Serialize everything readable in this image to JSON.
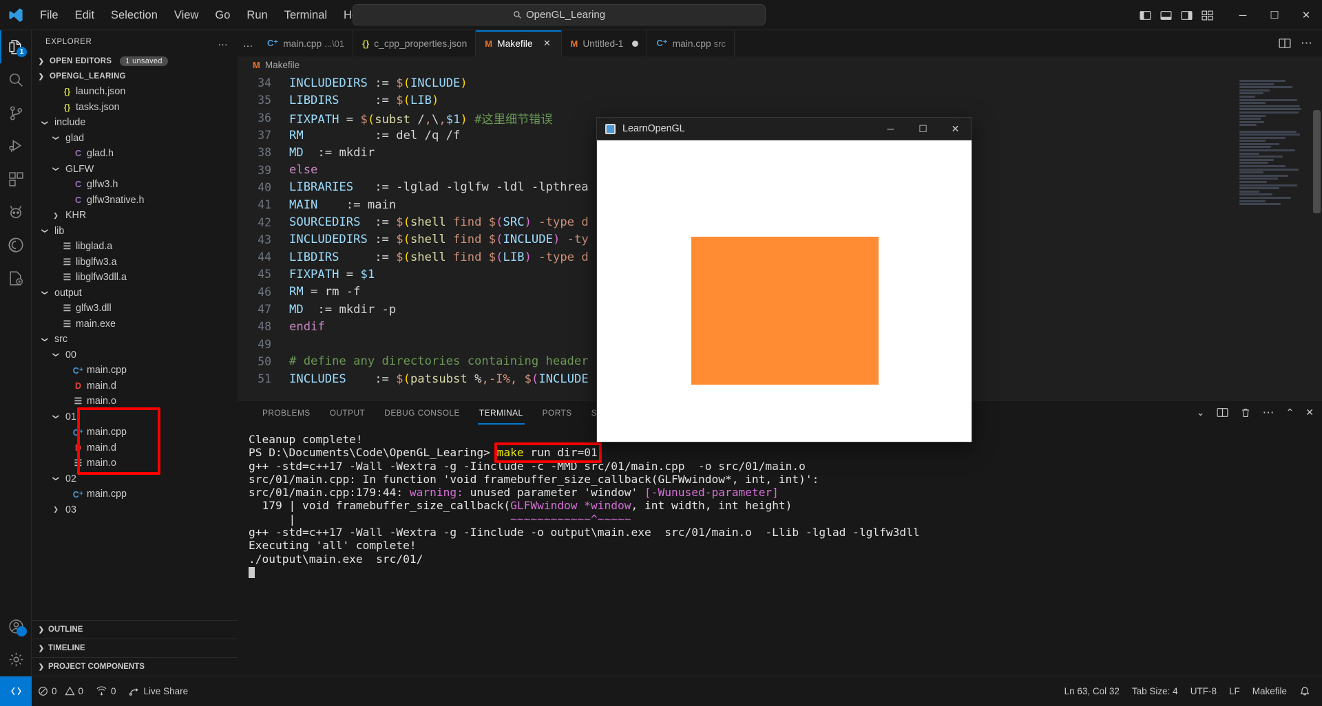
{
  "titlebar": {
    "menus": [
      "File",
      "Edit",
      "Selection",
      "View",
      "Go",
      "Run",
      "Terminal",
      "Help"
    ],
    "search_text": "OpenGL_Learing",
    "search_icon": "search-icon",
    "back_arrow": "←",
    "forward_arrow": "→",
    "minimize": "─",
    "maximize": "☐",
    "close": "✕"
  },
  "activitybar": {
    "items": [
      {
        "name": "explorer",
        "badge": "1",
        "active": true
      },
      {
        "name": "search",
        "badge": "",
        "active": false
      },
      {
        "name": "source-control",
        "badge": "",
        "active": false
      },
      {
        "name": "run-and-debug",
        "badge": "",
        "active": false
      },
      {
        "name": "extensions",
        "badge": "",
        "active": false
      },
      {
        "name": "platformio",
        "badge": "",
        "active": false
      },
      {
        "name": "remote-explorer",
        "badge": "",
        "active": false
      },
      {
        "name": "cpp-config",
        "badge": "",
        "active": false
      }
    ],
    "bottom": [
      {
        "name": "accounts",
        "badge": "1"
      },
      {
        "name": "settings",
        "badge": ""
      }
    ]
  },
  "sidebar": {
    "header_title": "EXPLORER",
    "more_actions": "…",
    "open_editors_label": "OPEN EDITORS",
    "open_editors_badge": "1 unsaved",
    "workspace_label": "OPENGL_LEARING",
    "tree": [
      {
        "indent": 1,
        "chev": "",
        "icon": "json",
        "icon_text": "{}",
        "label": "launch.json"
      },
      {
        "indent": 1,
        "chev": "",
        "icon": "json",
        "icon_text": "{}",
        "label": "tasks.json"
      },
      {
        "indent": 0,
        "chev": "⌄",
        "icon": "folder",
        "icon_text": "",
        "label": "include"
      },
      {
        "indent": 1,
        "chev": "⌄",
        "icon": "folder",
        "icon_text": "",
        "label": "glad"
      },
      {
        "indent": 2,
        "chev": "",
        "icon": "c",
        "icon_text": "C",
        "label": "glad.h"
      },
      {
        "indent": 1,
        "chev": "⌄",
        "icon": "folder",
        "icon_text": "",
        "label": "GLFW"
      },
      {
        "indent": 2,
        "chev": "",
        "icon": "c",
        "icon_text": "C",
        "label": "glfw3.h"
      },
      {
        "indent": 2,
        "chev": "",
        "icon": "c",
        "icon_text": "C",
        "label": "glfw3native.h"
      },
      {
        "indent": 1,
        "chev": "›",
        "icon": "folder",
        "icon_text": "",
        "label": "KHR"
      },
      {
        "indent": 0,
        "chev": "⌄",
        "icon": "folder",
        "icon_text": "",
        "label": "lib"
      },
      {
        "indent": 1,
        "chev": "",
        "icon": "file",
        "icon_text": "☰",
        "label": "libglad.a"
      },
      {
        "indent": 1,
        "chev": "",
        "icon": "file",
        "icon_text": "☰",
        "label": "libglfw3.a"
      },
      {
        "indent": 1,
        "chev": "",
        "icon": "file",
        "icon_text": "☰",
        "label": "libglfw3dll.a"
      },
      {
        "indent": 0,
        "chev": "⌄",
        "icon": "folder",
        "icon_text": "",
        "label": "output"
      },
      {
        "indent": 1,
        "chev": "",
        "icon": "file",
        "icon_text": "☰",
        "label": "glfw3.dll"
      },
      {
        "indent": 1,
        "chev": "",
        "icon": "file",
        "icon_text": "☰",
        "label": "main.exe"
      },
      {
        "indent": 0,
        "chev": "⌄",
        "icon": "folder",
        "icon_text": "",
        "label": "src"
      },
      {
        "indent": 1,
        "chev": "⌄",
        "icon": "folder",
        "icon_text": "",
        "label": "00"
      },
      {
        "indent": 2,
        "chev": "",
        "icon": "cpp",
        "icon_text": "C⁺",
        "label": "main.cpp"
      },
      {
        "indent": 2,
        "chev": "",
        "icon": "d",
        "icon_text": "D",
        "label": "main.d"
      },
      {
        "indent": 2,
        "chev": "",
        "icon": "file",
        "icon_text": "☰",
        "label": "main.o"
      },
      {
        "indent": 1,
        "chev": "⌄",
        "icon": "folder",
        "icon_text": "",
        "label": "01"
      },
      {
        "indent": 2,
        "chev": "",
        "icon": "cpp",
        "icon_text": "C⁺",
        "label": "main.cpp"
      },
      {
        "indent": 2,
        "chev": "",
        "icon": "d",
        "icon_text": "D",
        "label": "main.d"
      },
      {
        "indent": 2,
        "chev": "",
        "icon": "file",
        "icon_text": "☰",
        "label": "main.o"
      },
      {
        "indent": 1,
        "chev": "⌄",
        "icon": "folder",
        "icon_text": "",
        "label": "02"
      },
      {
        "indent": 2,
        "chev": "",
        "icon": "cpp",
        "icon_text": "C⁺",
        "label": "main.cpp"
      },
      {
        "indent": 1,
        "chev": "›",
        "icon": "folder",
        "icon_text": "",
        "label": "03"
      }
    ],
    "bottom_sections": [
      "OUTLINE",
      "TIMELINE",
      "PROJECT COMPONENTS"
    ],
    "annotation_color": "#ff0000"
  },
  "tabs": {
    "overflow": "…",
    "items": [
      {
        "icon": "cpp",
        "icon_text": "C⁺",
        "label": "main.cpp",
        "sub": "...\\01",
        "active": false,
        "dirty": false,
        "close": ""
      },
      {
        "icon": "json",
        "icon_text": "{}",
        "label": "c_cpp_properties.json",
        "sub": "",
        "active": false,
        "dirty": false,
        "close": ""
      },
      {
        "icon": "makefile",
        "icon_text": "M",
        "label": "Makefile",
        "sub": "",
        "active": true,
        "dirty": false,
        "close": "✕"
      },
      {
        "icon": "makefile",
        "icon_text": "M",
        "label": "Untitled-1",
        "sub": "",
        "active": false,
        "dirty": true,
        "close": ""
      },
      {
        "icon": "cpp",
        "icon_text": "C⁺",
        "label": "main.cpp",
        "sub": "src",
        "active": false,
        "dirty": false,
        "close": ""
      }
    ],
    "actions": [
      "split-editor-icon",
      "more-actions-icon"
    ]
  },
  "breadcrumb": {
    "icon_text": "M",
    "label": "Makefile"
  },
  "code": {
    "lines": [
      {
        "n": "34",
        "tokens": [
          {
            "t": "INCLUDEDIRS ",
            "c": "k-var"
          },
          {
            "t": ":= ",
            "c": "k-op"
          },
          {
            "t": "$",
            "c": "k-dollar"
          },
          {
            "t": "(",
            "c": "k-paren"
          },
          {
            "t": "INCLUDE",
            "c": "k-var"
          },
          {
            "t": ")",
            "c": "k-paren"
          }
        ]
      },
      {
        "n": "35",
        "tokens": [
          {
            "t": "LIBDIRS     ",
            "c": "k-var"
          },
          {
            "t": ":= ",
            "c": "k-op"
          },
          {
            "t": "$",
            "c": "k-dollar"
          },
          {
            "t": "(",
            "c": "k-paren"
          },
          {
            "t": "LIB",
            "c": "k-var"
          },
          {
            "t": ")",
            "c": "k-paren"
          }
        ]
      },
      {
        "n": "36",
        "tokens": [
          {
            "t": "FIXPATH ",
            "c": "k-var"
          },
          {
            "t": "= ",
            "c": "k-op"
          },
          {
            "t": "$",
            "c": "k-dollar"
          },
          {
            "t": "(",
            "c": "k-paren"
          },
          {
            "t": "subst ",
            "c": "k-func"
          },
          {
            "t": "/",
            "c": "k-plain"
          },
          {
            "t": ",",
            "c": "k-dollar"
          },
          {
            "t": "\\",
            "c": "k-plain"
          },
          {
            "t": ",",
            "c": "k-dollar"
          },
          {
            "t": "$1",
            "c": "k-var"
          },
          {
            "t": ")",
            "c": "k-paren"
          },
          {
            "t": " #这里细节错误",
            "c": "k-com"
          }
        ]
      },
      {
        "n": "37",
        "tokens": [
          {
            "t": "RM          ",
            "c": "k-var"
          },
          {
            "t": ":= ",
            "c": "k-op"
          },
          {
            "t": "del /q /f",
            "c": "k-plain"
          }
        ]
      },
      {
        "n": "38",
        "tokens": [
          {
            "t": "MD  ",
            "c": "k-var"
          },
          {
            "t": ":= ",
            "c": "k-op"
          },
          {
            "t": "mkdir",
            "c": "k-plain"
          }
        ]
      },
      {
        "n": "39",
        "tokens": [
          {
            "t": "else",
            "c": "k-kw"
          }
        ]
      },
      {
        "n": "40",
        "tokens": [
          {
            "t": "LIBRARIES   ",
            "c": "k-var"
          },
          {
            "t": ":= ",
            "c": "k-op"
          },
          {
            "t": "-lglad -lglfw -ldl -lpthrea",
            "c": "k-plain"
          }
        ]
      },
      {
        "n": "41",
        "tokens": [
          {
            "t": "MAIN    ",
            "c": "k-var"
          },
          {
            "t": ":= ",
            "c": "k-op"
          },
          {
            "t": "main",
            "c": "k-plain"
          }
        ]
      },
      {
        "n": "42",
        "tokens": [
          {
            "t": "SOURCEDIRS  ",
            "c": "k-var"
          },
          {
            "t": ":= ",
            "c": "k-op"
          },
          {
            "t": "$",
            "c": "k-dollar"
          },
          {
            "t": "(",
            "c": "k-paren"
          },
          {
            "t": "shell ",
            "c": "k-func"
          },
          {
            "t": "find ",
            "c": "k-str"
          },
          {
            "t": "$",
            "c": "k-dollar"
          },
          {
            "t": "(",
            "c": "k-paren2"
          },
          {
            "t": "SRC",
            "c": "k-var"
          },
          {
            "t": ")",
            "c": "k-paren2"
          },
          {
            "t": " -type ",
            "c": "k-str"
          },
          {
            "t": "d",
            "c": "k-str"
          }
        ]
      },
      {
        "n": "43",
        "tokens": [
          {
            "t": "INCLUDEDIRS ",
            "c": "k-var"
          },
          {
            "t": ":= ",
            "c": "k-op"
          },
          {
            "t": "$",
            "c": "k-dollar"
          },
          {
            "t": "(",
            "c": "k-paren"
          },
          {
            "t": "shell ",
            "c": "k-func"
          },
          {
            "t": "find ",
            "c": "k-str"
          },
          {
            "t": "$",
            "c": "k-dollar"
          },
          {
            "t": "(",
            "c": "k-paren2"
          },
          {
            "t": "INCLUDE",
            "c": "k-var"
          },
          {
            "t": ")",
            "c": "k-paren2"
          },
          {
            "t": " -ty",
            "c": "k-str"
          }
        ]
      },
      {
        "n": "44",
        "tokens": [
          {
            "t": "LIBDIRS     ",
            "c": "k-var"
          },
          {
            "t": ":= ",
            "c": "k-op"
          },
          {
            "t": "$",
            "c": "k-dollar"
          },
          {
            "t": "(",
            "c": "k-paren"
          },
          {
            "t": "shell ",
            "c": "k-func"
          },
          {
            "t": "find ",
            "c": "k-str"
          },
          {
            "t": "$",
            "c": "k-dollar"
          },
          {
            "t": "(",
            "c": "k-paren2"
          },
          {
            "t": "LIB",
            "c": "k-var"
          },
          {
            "t": ")",
            "c": "k-paren2"
          },
          {
            "t": " -type ",
            "c": "k-str"
          },
          {
            "t": "d",
            "c": "k-str"
          }
        ]
      },
      {
        "n": "45",
        "tokens": [
          {
            "t": "FIXPATH ",
            "c": "k-var"
          },
          {
            "t": "= ",
            "c": "k-op"
          },
          {
            "t": "$1",
            "c": "k-var"
          }
        ]
      },
      {
        "n": "46",
        "tokens": [
          {
            "t": "RM ",
            "c": "k-var"
          },
          {
            "t": "= ",
            "c": "k-op"
          },
          {
            "t": "rm -f",
            "c": "k-plain"
          }
        ]
      },
      {
        "n": "47",
        "tokens": [
          {
            "t": "MD  ",
            "c": "k-var"
          },
          {
            "t": ":= ",
            "c": "k-op"
          },
          {
            "t": "mkdir -p",
            "c": "k-plain"
          }
        ]
      },
      {
        "n": "48",
        "tokens": [
          {
            "t": "endif",
            "c": "k-kw"
          }
        ]
      },
      {
        "n": "49",
        "tokens": []
      },
      {
        "n": "50",
        "tokens": [
          {
            "t": "# define any directories containing header",
            "c": "k-com"
          }
        ]
      },
      {
        "n": "51",
        "tokens": [
          {
            "t": "INCLUDES    ",
            "c": "k-var"
          },
          {
            "t": ":= ",
            "c": "k-op"
          },
          {
            "t": "$",
            "c": "k-dollar"
          },
          {
            "t": "(",
            "c": "k-paren"
          },
          {
            "t": "patsubst ",
            "c": "k-func"
          },
          {
            "t": "%",
            "c": "k-plain"
          },
          {
            "t": ",",
            "c": "k-dollar"
          },
          {
            "t": "-I%",
            "c": "k-str"
          },
          {
            "t": ", ",
            "c": "k-dollar"
          },
          {
            "t": "$",
            "c": "k-dollar"
          },
          {
            "t": "(",
            "c": "k-paren2"
          },
          {
            "t": "INCLUDE",
            "c": "k-var"
          }
        ]
      }
    ]
  },
  "panel": {
    "tabs": [
      "PROBLEMS",
      "OUTPUT",
      "DEBUG CONSOLE",
      "TERMINAL",
      "PORTS",
      "SERIAL MONITOR"
    ],
    "active_tab": "TERMINAL",
    "actions": [
      "chevron-down-icon",
      "split-terminal-icon",
      "kill-terminal-icon",
      "more-actions-icon",
      "maximize-panel-icon",
      "close-panel-icon"
    ],
    "terminal_lines": [
      [
        {
          "t": "Cleanup complete!",
          "c": "t-white"
        }
      ],
      [
        {
          "t": "PS D:\\Documents\\Code\\OpenGL_Learing> ",
          "c": "t-white"
        },
        {
          "t": "make",
          "c": "t-yellow"
        },
        {
          "t": " run dir=01",
          "c": "t-white"
        }
      ],
      [
        {
          "t": "g++ -std=c++17 -Wall -Wextra -g -Iinclude -c -MMD src/01/main.cpp  -o src/01/main.o",
          "c": "t-white"
        }
      ],
      [
        {
          "t": "src/01/main.cpp: In function 'void framebuffer_size_callback(GLFWwindow*, int, int)':",
          "c": "t-white"
        }
      ],
      [
        {
          "t": "src/01/main.cpp:179:44: ",
          "c": "t-white"
        },
        {
          "t": "warning: ",
          "c": "t-magenta"
        },
        {
          "t": "unused parameter 'window' ",
          "c": "t-white"
        },
        {
          "t": "[-Wunused-parameter]",
          "c": "t-magenta"
        }
      ],
      [
        {
          "t": "  179 | void framebuffer_size_callback(",
          "c": "t-white"
        },
        {
          "t": "GLFWwindow *window",
          "c": "t-magenta"
        },
        {
          "t": ", int width, int height)",
          "c": "t-white"
        }
      ],
      [
        {
          "t": "      |                                ",
          "c": "t-white"
        },
        {
          "t": "~~~~~~~~~~~~^~~~~~",
          "c": "t-magenta"
        }
      ],
      [
        {
          "t": "g++ -std=c++17 -Wall -Wextra -g -Iinclude -o output\\main.exe  src/01/main.o  -Llib -lglad -lglfw3dll",
          "c": "t-white"
        }
      ],
      [
        {
          "t": "Executing 'all' complete!",
          "c": "t-white"
        }
      ],
      [
        {
          "t": "./output\\main.exe  src/01/",
          "c": "t-white"
        }
      ]
    ],
    "highlight_text": "make run dir=01",
    "annotation_color": "#ff0000"
  },
  "glwindow": {
    "title": "LearnOpenGL",
    "minimize": "─",
    "maximize": "☐",
    "close": "✕",
    "canvas_bg": "#ffffff",
    "rect_color": "#ff8c32"
  },
  "statusbar": {
    "remote_icon": "remote-window-icon",
    "errors": "0",
    "warnings": "0",
    "ports": "0",
    "live_share": "Live Share",
    "cursor_position": "Ln 63, Col 32",
    "tab_size": "Tab Size: 4",
    "encoding": "UTF-8",
    "eol": "LF",
    "language": "Makefile",
    "bell": "notifications-icon"
  }
}
